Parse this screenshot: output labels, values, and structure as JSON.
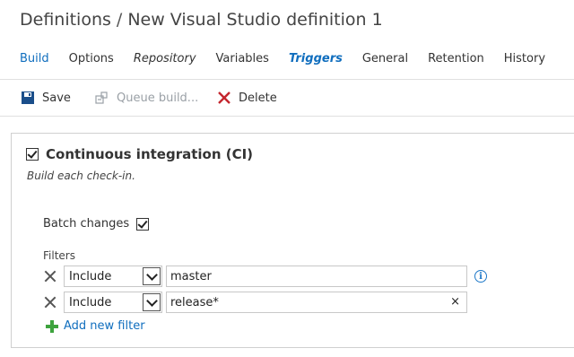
{
  "header": {
    "breadcrumb_root": "Definitions",
    "separator": "/",
    "definition_name": "New Visual Studio definition 1"
  },
  "tabs": [
    {
      "label": "Build"
    },
    {
      "label": "Options"
    },
    {
      "label": "Repository"
    },
    {
      "label": "Variables"
    },
    {
      "label": "Triggers"
    },
    {
      "label": "General"
    },
    {
      "label": "Retention"
    },
    {
      "label": "History"
    }
  ],
  "toolbar": {
    "save_label": "Save",
    "queue_label": "Queue build...",
    "delete_label": "Delete"
  },
  "ci": {
    "label": "Continuous integration (CI)",
    "checked": true,
    "description": "Build each check-in.",
    "batch_label": "Batch changes",
    "batch_checked": true,
    "filters_label": "Filters",
    "filters": [
      {
        "type": "Include",
        "value": "master"
      },
      {
        "type": "Include",
        "value": "release*"
      }
    ],
    "add_filter_label": "Add new filter",
    "clear_glyph": "×",
    "info_glyph": "i"
  },
  "colors": {
    "accent": "#106ebe",
    "save_icon": "#1a4e8a",
    "delete_icon": "#c4262e",
    "add_icon": "#3ea33e"
  }
}
